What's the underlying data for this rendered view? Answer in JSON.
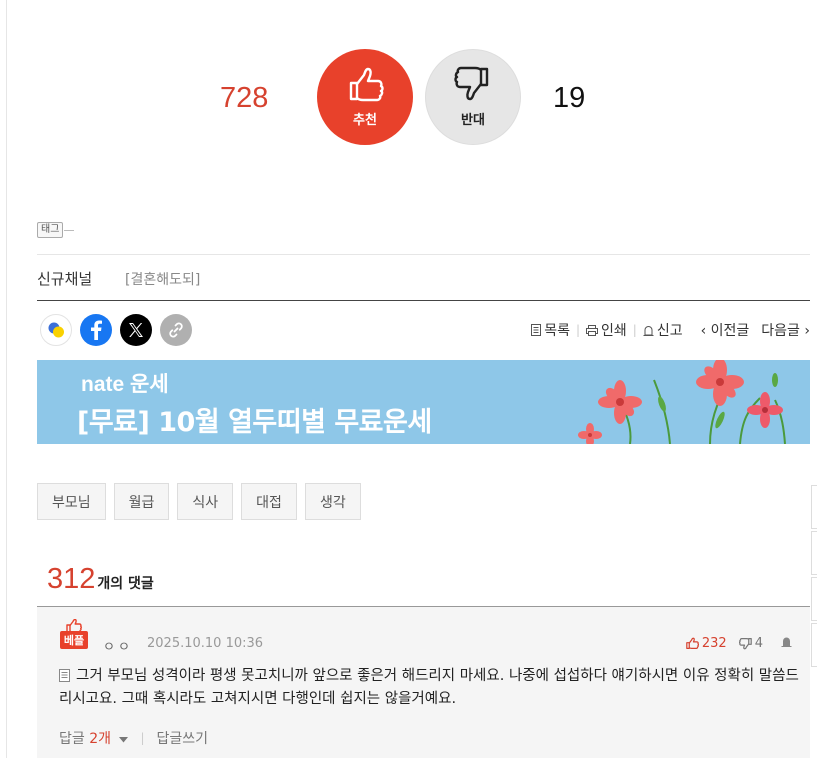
{
  "vote": {
    "up_count": "728",
    "up_label": "추천",
    "down_label": "반대",
    "down_count": "19"
  },
  "tag": {
    "label": "태그"
  },
  "channel": {
    "name": "신규채널",
    "sub": "[결혼해도되]"
  },
  "toolbar": {
    "list": "목록",
    "print": "인쇄",
    "report": "신고",
    "prev": "‹ 이전글",
    "next": "다음글 ›"
  },
  "banner": {
    "brand": "nate 운세",
    "headline": "[무료] 10월 열두띠별 무료운세"
  },
  "keywords": [
    "부모님",
    "월급",
    "식사",
    "대접",
    "생각"
  ],
  "comments": {
    "count": "312",
    "count_suffix": "개의 댓글",
    "items": [
      {
        "badge": "베플",
        "author": "ㅇㅇ",
        "date": "2025.10.10 10:36",
        "up": "232",
        "down": "4",
        "body": "그거 부모님 성격이라 평생 못고치니까 앞으로 좋은거 해드리지 마세요. 나중에 섭섭하다 얘기하시면 이유 정확히 말씀드리시고요. 그때 혹시라도 고쳐지시면 다행인데 쉽지는 않을거예요.",
        "reply_label": "답글",
        "reply_count": "2개",
        "write_reply": "답글쓰기"
      }
    ]
  },
  "colors": {
    "accent": "#e8412b",
    "banner_bg": "#8ec7e8",
    "facebook": "#1877f2"
  }
}
